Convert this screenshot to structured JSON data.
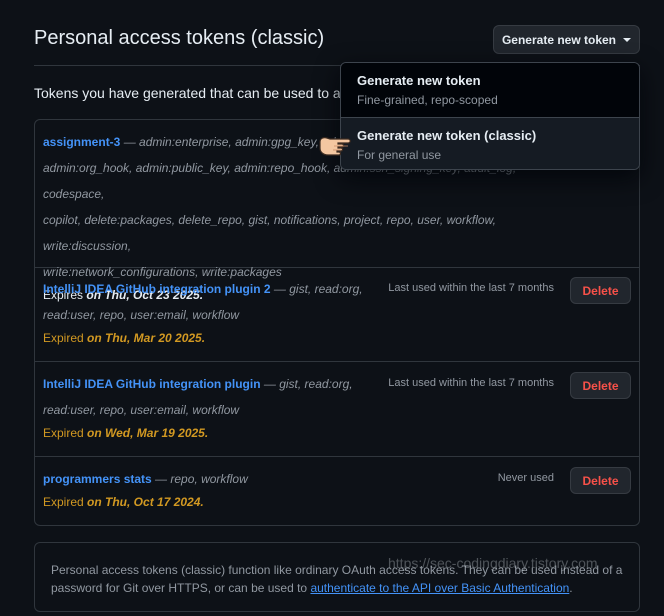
{
  "header": {
    "title": "Personal access tokens (classic)",
    "generate_button": "Generate new token"
  },
  "intro_text": "Tokens you have generated that can be used to ac",
  "tokens": [
    {
      "name": "assignment-3",
      "scopes_line1": " — admin:enterprise, admin:gpg_key, ad",
      "scopes_line2": "admin:org_hook, admin:public_key, admin:repo_hook, admin:ssh_signing_key, audit_log, codespace,",
      "scopes_line3": "copilot, delete:packages, delete_repo, gist, notifications, project, repo, user, workflow, write:discussion,",
      "scopes_line4": "write:network_configurations, write:packages",
      "expires_prefix": "Expires ",
      "expires_date": "on Thu, Oct 23 2025."
    },
    {
      "name": "IntelliJ IDEA GitHub integration plugin 2",
      "scopes_line1": " — gist, read:org,",
      "scopes_line2": "read:user, repo, user:email, workflow",
      "expires_prefix": "Expired ",
      "expires_date": "on Thu, Mar 20 2025.",
      "last_used": "Last used within the last 7 months",
      "delete": "Delete"
    },
    {
      "name": "IntelliJ IDEA GitHub integration plugin",
      "scopes_line1": " — gist, read:org,",
      "scopes_line2": "read:user, repo, user:email, workflow",
      "expires_prefix": "Expired ",
      "expires_date": "on Wed, Mar 19 2025.",
      "last_used": "Last used within the last 7 months",
      "delete": "Delete"
    },
    {
      "name": "programmers stats",
      "scopes_line1": " — repo, workflow",
      "expires_prefix": "Expired ",
      "expires_date": "on Thu, Oct 17 2024.",
      "last_used": "Never used",
      "delete": "Delete"
    }
  ],
  "note": {
    "text_1": "Personal access tokens (classic) function like ordinary OAuth access tokens. They can be used instead of a password for Git over HTTPS, or can be used to ",
    "link": "authenticate to the API over Basic Authentication",
    "text_2": "."
  },
  "watermark": "https://sec-codingdiary.tistory.com",
  "dropdown": {
    "items": [
      {
        "title": "Generate new token",
        "subtitle": "Fine-grained, repo-scoped"
      },
      {
        "title": "Generate new token (classic)",
        "subtitle": "For general use"
      }
    ]
  },
  "colors": {
    "background": "#0d1117",
    "link": "#4493f8",
    "expired": "#d29922",
    "danger": "#f85149",
    "border": "#30363d"
  },
  "icons": {
    "caret": "triangle-down-icon",
    "cursor": "pointing-hand-cursor-icon"
  }
}
